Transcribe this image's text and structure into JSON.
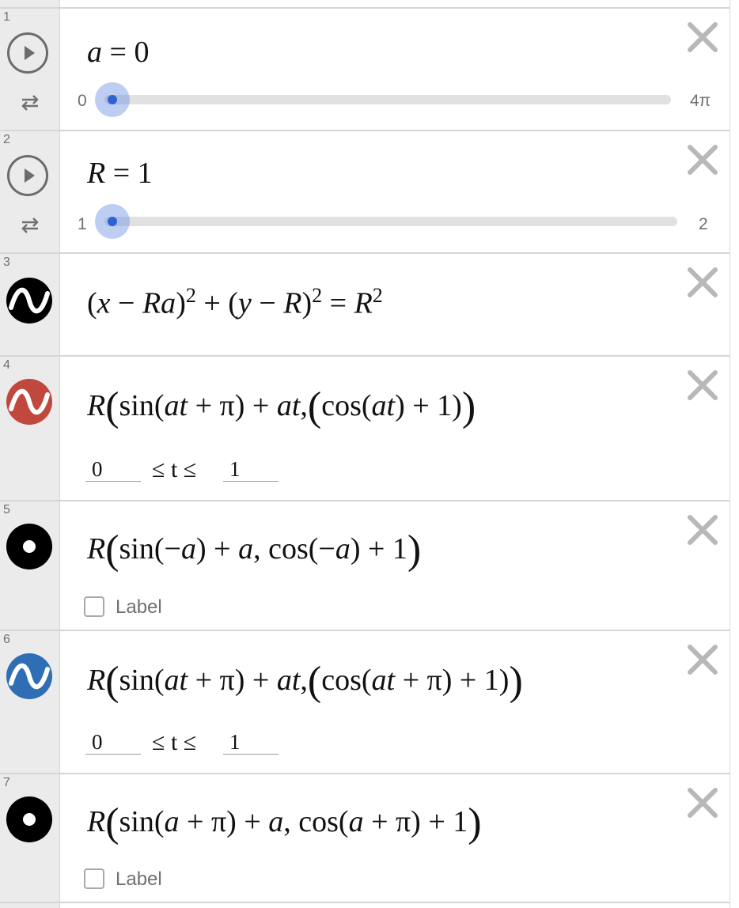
{
  "rows": [
    {
      "num": "1",
      "a_var": "a",
      "eq": " = ",
      "val": "0",
      "min": "0",
      "max": "4π"
    },
    {
      "num": "2",
      "a_var": "R",
      "eq": " = ",
      "val": "1",
      "min": "1",
      "max": "2"
    },
    {
      "num": "3"
    },
    {
      "num": "4",
      "t_min": "0",
      "t_max": "1"
    },
    {
      "num": "5",
      "label": "Label"
    },
    {
      "num": "6",
      "t_min": "0",
      "t_max": "1"
    },
    {
      "num": "7",
      "label": "Label"
    }
  ],
  "slider_values": {
    "a": {
      "value": 0,
      "min": 0,
      "max": "4π"
    },
    "R": {
      "value": 1,
      "min": 1,
      "max": 2
    }
  },
  "ineq_text": "≤ t ≤",
  "icons": {
    "play": "play-icon",
    "repeat": "repeat-icon",
    "curve_black": "curve-black-icon",
    "curve_red": "curve-red-icon",
    "curve_blue": "curve-blue-icon",
    "point": "point-icon",
    "close": "close-icon"
  },
  "colors": {
    "slider_thumb": "#2f62d1",
    "curve_red": "#c0483d",
    "curve_blue": "#2f6db4",
    "gutter": "#ebebeb"
  }
}
